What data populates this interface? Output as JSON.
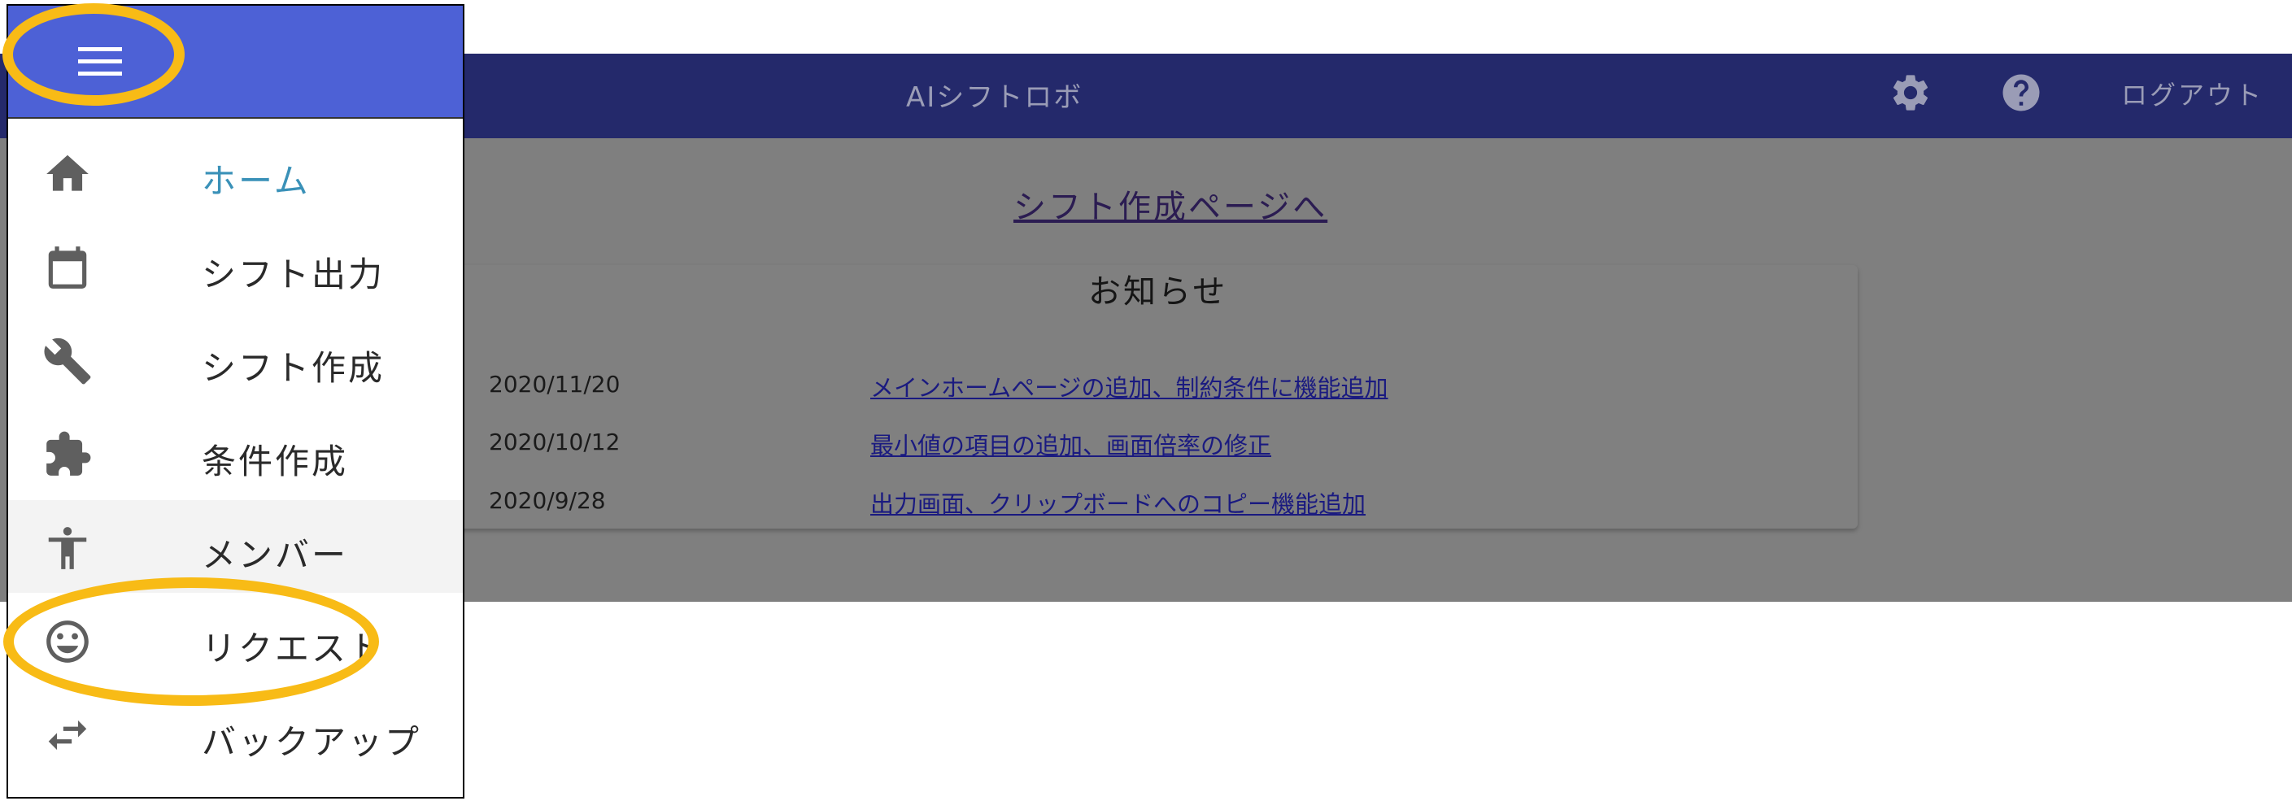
{
  "app": {
    "title": "AIシフトロボ",
    "logout_label": "ログアウト",
    "create_shift_link": "シフト作成ページへ"
  },
  "news": {
    "title": "お知らせ",
    "items": [
      {
        "date": "2020/11/20",
        "text": "メインホームページの追加、制約条件に機能追加"
      },
      {
        "date": "2020/10/12",
        "text": "最小値の項目の追加、画面倍率の修正"
      },
      {
        "date": "2020/9/28",
        "text": "出力画面、クリップボードへのコピー機能追加"
      }
    ]
  },
  "drawer": {
    "items": [
      {
        "label": "ホーム",
        "icon": "home-icon"
      },
      {
        "label": "シフト出力",
        "icon": "calendar-icon"
      },
      {
        "label": "シフト作成",
        "icon": "wrench-icon"
      },
      {
        "label": "条件作成",
        "icon": "puzzle-icon"
      },
      {
        "label": "メンバー",
        "icon": "person-icon"
      },
      {
        "label": "リクエスト",
        "icon": "smiley-icon"
      },
      {
        "label": "バックアップ",
        "icon": "swap-arrows-icon"
      }
    ]
  },
  "colors": {
    "drawer_header": "#4d61d6",
    "app_bar_dimmed": "#24296b",
    "active_item": "#3a91b8",
    "highlight": "#f8bb16"
  }
}
